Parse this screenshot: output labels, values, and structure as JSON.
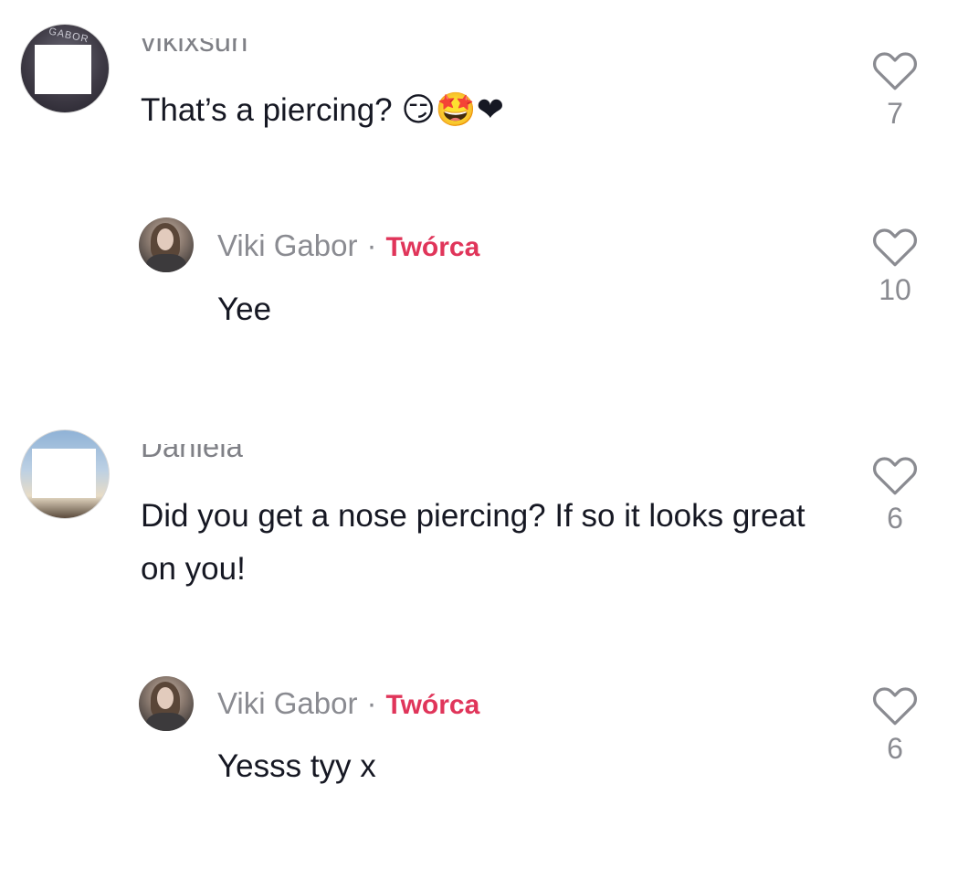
{
  "comments": [
    {
      "username": "vikixsun",
      "text": "That’s a piercing? 😏🤩❤️",
      "text_plain": "That’s a piercing?",
      "emojis": "😏🤩❤",
      "likes": "7",
      "avatar_text": "GABOR"
    },
    {
      "username": "Viki Gabor",
      "separator": "·",
      "creator_label": "Twórca",
      "text": "Yee",
      "likes": "10"
    },
    {
      "username": "Daniela",
      "text": "Did you get a nose piercing? If so it looks great on you!",
      "likes": "6"
    },
    {
      "username": "Viki Gabor",
      "separator": "·",
      "creator_label": "Twórca",
      "text": "Yesss tyy x",
      "likes": "6"
    }
  ],
  "colors": {
    "creator_accent": "#e0355a",
    "muted_text": "#8a8b91",
    "primary_text": "#161823"
  },
  "icons": {
    "like": "heart-outline-icon"
  }
}
